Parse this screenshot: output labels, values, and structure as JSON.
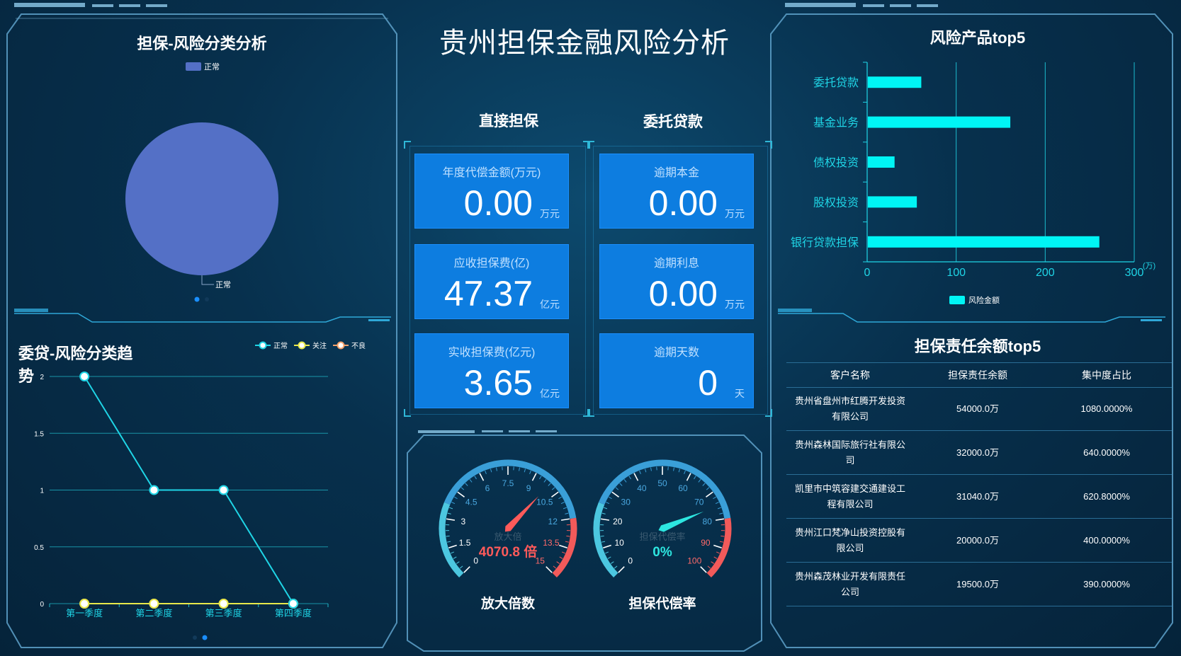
{
  "header": {
    "title": "贵州担保金融风险分析"
  },
  "pie_panel": {
    "title": "担保-风险分类分析",
    "chart_data": {
      "type": "pie",
      "title": "担保-风险分类分析",
      "legend": [
        "正常"
      ],
      "legend_position": "top",
      "slices": [
        {
          "name": "正常",
          "value": 100,
          "color": "#5470c6"
        }
      ],
      "slice_label": "正常"
    }
  },
  "line_panel": {
    "title": "委贷-风险分类趋势",
    "chart_data": {
      "type": "line",
      "title": "委贷-风险分类趋势",
      "categories": [
        "第一季度",
        "第二季度",
        "第三季度",
        "第四季度"
      ],
      "ylim": [
        0,
        2
      ],
      "yticks": [
        "0",
        "0.5",
        "1",
        "1.5",
        "2"
      ],
      "legend_position": "top-right",
      "series": [
        {
          "name": "正常",
          "values": [
            2,
            1,
            1,
            0
          ],
          "color": "#1fd5e6"
        },
        {
          "name": "关注",
          "values": [
            0,
            0,
            0,
            0
          ],
          "color": "#e8e84a"
        },
        {
          "name": "不良",
          "values": [
            0,
            0,
            0,
            0
          ],
          "color": "#f2a06a"
        }
      ],
      "grid": true
    }
  },
  "center": {
    "group_left_title": "直接担保",
    "group_right_title": "委托贷款",
    "cards": [
      {
        "label": "年度代偿金额(万元)",
        "value": "0.00",
        "unit": "万元"
      },
      {
        "label": "应收担保费(亿)",
        "value": "47.37",
        "unit": "亿元"
      },
      {
        "label": "实收担保费(亿元)",
        "value": "3.65",
        "unit": "亿元"
      },
      {
        "label": "逾期本金",
        "value": "0.00",
        "unit": "万元"
      },
      {
        "label": "逾期利息",
        "value": "0.00",
        "unit": "万元"
      },
      {
        "label": "逾期天数",
        "value": "0",
        "unit": "天"
      }
    ]
  },
  "gauges": [
    {
      "title": "放大倍数",
      "inner_label": "放大倍",
      "value_text": "4070.8 倍",
      "value_color": "#ff5a5a",
      "min": 0,
      "max": 15,
      "ticks": [
        "0",
        "1.5",
        "3",
        "4.5",
        "6",
        "7.5",
        "9",
        "10.5",
        "12",
        "13.5",
        "15"
      ],
      "pointer_fraction": 0.66,
      "pointer_color": "#ff5a5a"
    },
    {
      "title": "担保代偿率",
      "inner_label": "担保代偿率",
      "value_text": "0%",
      "value_color": "#2de6e0",
      "min": 0,
      "max": 100,
      "ticks": [
        "0",
        "10",
        "20",
        "30",
        "40",
        "50",
        "60",
        "70",
        "80",
        "90",
        "100"
      ],
      "pointer_fraction": 0.75,
      "pointer_color": "#2de6e0"
    }
  ],
  "bar_panel": {
    "title": "风险产品top5",
    "chart_data": {
      "type": "bar",
      "orientation": "horizontal",
      "title": "风险产品top5",
      "categories": [
        "委托贷款",
        "基金业务",
        "债权投资",
        "股权投资",
        "银行贷款担保"
      ],
      "values": [
        60,
        160,
        30,
        55,
        260
      ],
      "xlim": [
        0,
        300
      ],
      "xticks": [
        "0",
        "100",
        "200",
        "300"
      ],
      "unit_label": "(万)",
      "legend": [
        "风险金额"
      ],
      "legend_position": "bottom",
      "color": "#00f5f5"
    }
  },
  "table_panel": {
    "title": "担保责任余额top5",
    "columns": [
      "客户名称",
      "担保责任余额",
      "集中度占比"
    ],
    "rows": [
      [
        "贵州省盘州市红腾开发投资有限公司",
        "54000.0万",
        "1080.0000%"
      ],
      [
        "贵州森林国际旅行社有限公司",
        "32000.0万",
        "640.0000%"
      ],
      [
        "凯里市中筑容建交通建设工程有限公司",
        "31040.0万",
        "620.8000%"
      ],
      [
        "贵州江口梵净山投资控股有限公司",
        "20000.0万",
        "400.0000%"
      ],
      [
        "贵州森茂林业开发有限责任公司",
        "19500.0万",
        "390.0000%"
      ]
    ]
  },
  "colors": {
    "accent": "#1fd5e6",
    "card": "#0d7de0",
    "frame": "#4a8fb8"
  }
}
